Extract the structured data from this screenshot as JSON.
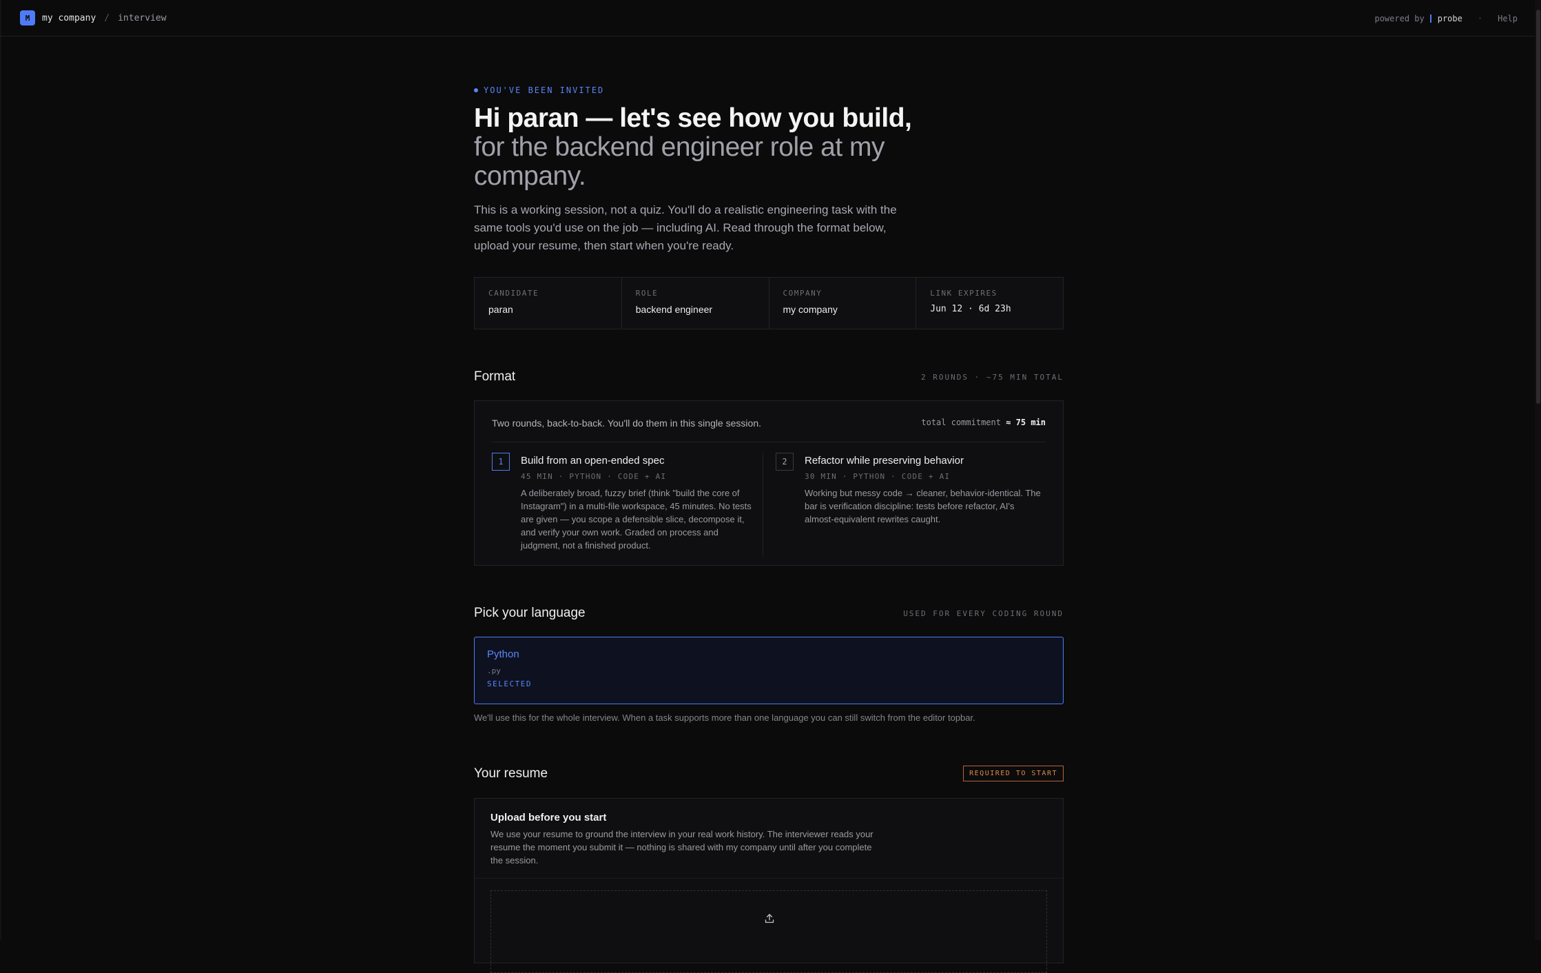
{
  "header": {
    "logo_letter": "M",
    "company": "my company",
    "separator": "/",
    "page": "interview",
    "powered_by": "powered by",
    "probe": "probe",
    "dot": "·",
    "help": "Help"
  },
  "hero": {
    "eyebrow": "YOU'VE BEEN INVITED",
    "title_line1": "Hi paran — let's see how you build,",
    "title_line2": "for the backend engineer role at my company.",
    "intro": "This is a working session, not a quiz. You'll do a realistic engineering task with the same tools you'd use on the job — including AI. Read through the format below, upload your resume, then start when you're ready."
  },
  "meta": [
    {
      "label": "CANDIDATE",
      "value": "paran"
    },
    {
      "label": "ROLE",
      "value": "backend engineer"
    },
    {
      "label": "COMPANY",
      "value": "my company"
    },
    {
      "label": "LINK EXPIRES",
      "value": "Jun 12 · 6d 23h"
    }
  ],
  "format": {
    "title": "Format",
    "summary": "2 ROUNDS · ~75 MIN TOTAL",
    "description": "Two rounds, back-to-back. You'll do them in this single session.",
    "total_label": "total commitment",
    "total_value": "≈ 75 min",
    "rounds": [
      {
        "number": "1",
        "title": "Build from an open-ended spec",
        "meta": "45 MIN · PYTHON · CODE + AI",
        "description": "A deliberately broad, fuzzy brief (think \"build the core of Instagram\") in a multi-file workspace, 45 minutes. No tests are given — you scope a defensible slice, decompose it, and verify your own work. Graded on process and judgment, not a finished product."
      },
      {
        "number": "2",
        "title": "Refactor while preserving behavior",
        "meta": "30 MIN · PYTHON · CODE + AI",
        "description": "Working but messy code → cleaner, behavior-identical. The bar is verification discipline: tests before refactor, AI's almost-equivalent rewrites caught."
      }
    ]
  },
  "language": {
    "title": "Pick your language",
    "meta": "USED FOR EVERY CODING ROUND",
    "selected_name": "Python",
    "selected_ext": ".py",
    "selected_tag": "SELECTED",
    "note": "We'll use this for the whole interview. When a task supports more than one language you can still switch from the editor topbar."
  },
  "resume": {
    "title": "Your resume",
    "badge": "REQUIRED TO START",
    "box_title": "Upload before you start",
    "box_desc": "We use your resume to ground the interview in your real work history. The interviewer reads your resume the moment you submit it — nothing is shared with my company until after you complete the session."
  },
  "colors": {
    "background": "#0b0b0c",
    "accent": "#4f7cf6",
    "warning": "#e0894a"
  }
}
